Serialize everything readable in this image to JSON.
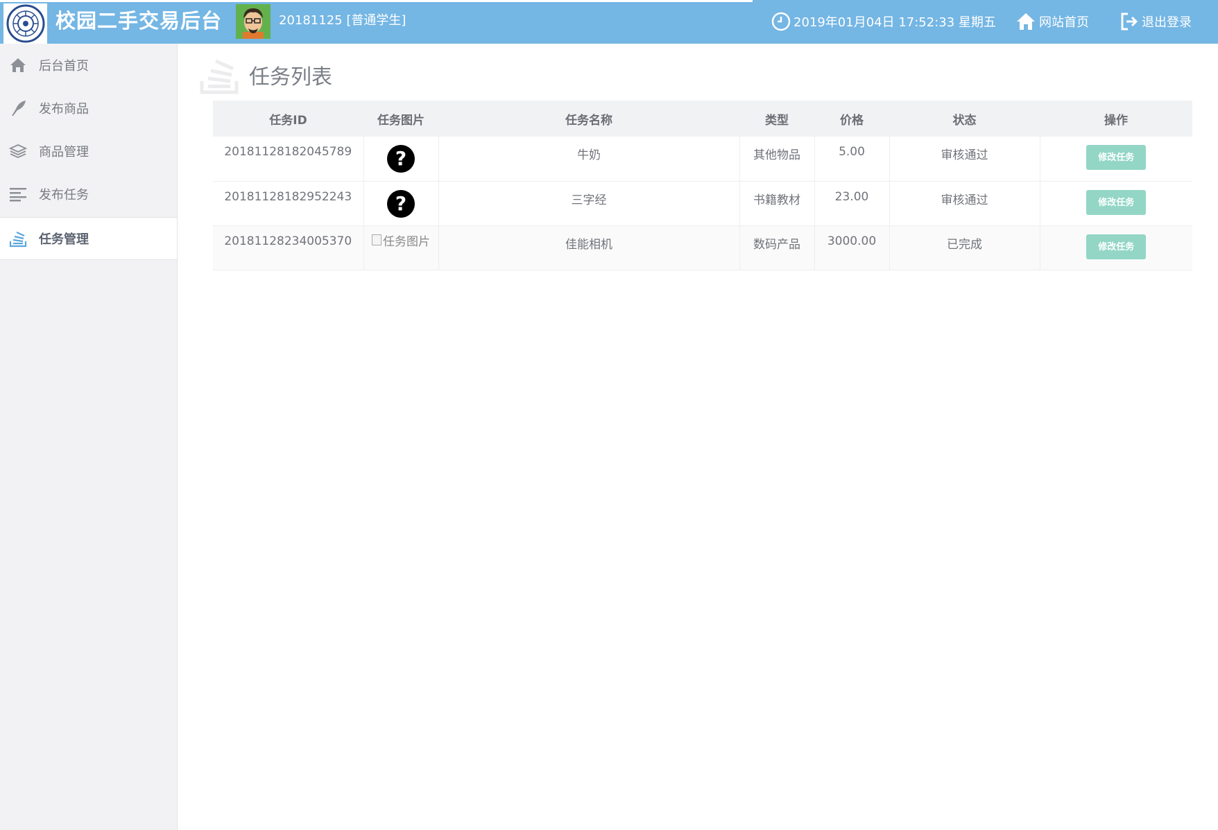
{
  "header": {
    "app_title": "校园二手交易后台",
    "user_info": "20181125 [普通学生]",
    "datetime": "2019年01月04日 17:52:33 星期五",
    "home_link": "网站首页",
    "logout_link": "退出登录",
    "bg_color": "#74b6e4"
  },
  "sidebar": {
    "items": [
      {
        "label": "后台首页",
        "icon": "home-icon"
      },
      {
        "label": "发布商品",
        "icon": "feather-icon"
      },
      {
        "label": "商品管理",
        "icon": "layers-icon"
      },
      {
        "label": "发布任务",
        "icon": "align-left-icon"
      },
      {
        "label": "任务管理",
        "icon": "stack-icon",
        "active": true
      }
    ]
  },
  "main": {
    "title": "任务列表",
    "table": {
      "columns": [
        "任务ID",
        "任务图片",
        "任务名称",
        "类型",
        "价格",
        "状态",
        "操作"
      ],
      "rows": [
        {
          "id": "20181128182045789",
          "image": "question-icon",
          "name": "牛奶",
          "type": "其他物品",
          "price": "5.00",
          "status": "审核通过",
          "action": "修改任务"
        },
        {
          "id": "20181128182952243",
          "image": "question-icon",
          "name": "三字经",
          "type": "书籍教材",
          "price": "23.00",
          "status": "审核通过",
          "action": "修改任务"
        },
        {
          "id": "20181128234005370",
          "image_alt": "任务图片",
          "name": "佳能相机",
          "type": "数码产品",
          "price": "3000.00",
          "status": "已完成",
          "action": "修改任务"
        }
      ]
    },
    "button_color": "#93d6c6"
  }
}
